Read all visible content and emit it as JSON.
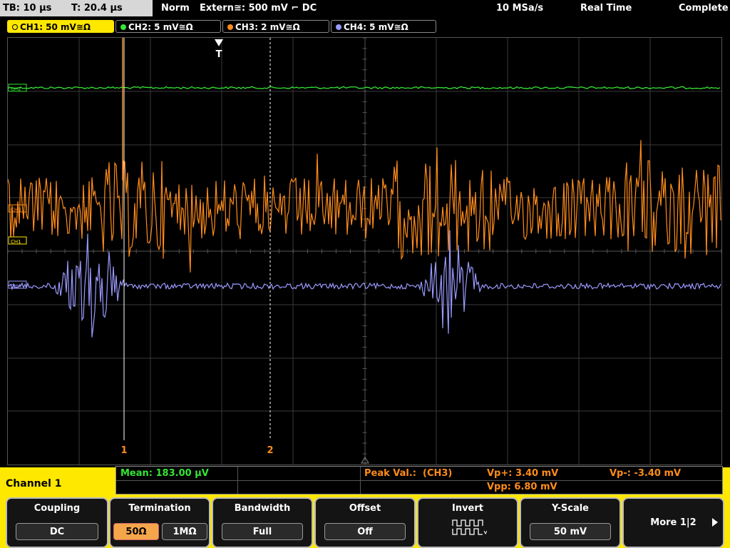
{
  "status": {
    "timebase": "TB: 10 µs",
    "trigger_time": "T: 20.4 µs",
    "mode": "Norm",
    "trigger_source": "Extern≅: 500 mV ⌐ DC",
    "sample_rate": "10 MSa/s",
    "acq_mode": "Real Time",
    "acq_state": "Complete"
  },
  "channels": [
    {
      "label": "CH1: 50 mV≅Ω",
      "color": "#ffe800",
      "active": true
    },
    {
      "label": "CH2: 5 mV≅Ω",
      "color": "#35e535"
    },
    {
      "label": "CH3: 2 mV≅Ω",
      "color": "#ff8c1a"
    },
    {
      "label": "CH4: 5 mV≅Ω",
      "color": "#9a9aff"
    }
  ],
  "trigger_marker": "T",
  "markers": {
    "m1": "1",
    "m2": "2"
  },
  "channel_refs": {
    "ch2": "CH2",
    "ch3": "CH3",
    "ch1": "CH1",
    "ch4": "CH4"
  },
  "measurements": {
    "mean": "Mean: 183.00 µV",
    "peak_label": "Peak Val.:",
    "peak_source": "(CH3)",
    "vp_plus": "Vp+: 3.40 mV",
    "vp_minus": "Vp-: -3.40 mV",
    "vpp": "Vpp: 6.80 mV"
  },
  "panel_title": "Channel 1",
  "softkeys": {
    "coupling": {
      "title": "Coupling",
      "value": "DC"
    },
    "termination": {
      "title": "Termination",
      "opt1": "50Ω",
      "opt2": "1MΩ"
    },
    "bandwidth": {
      "title": "Bandwidth",
      "value": "Full"
    },
    "offset": {
      "title": "Offset",
      "value": "Off"
    },
    "invert": {
      "title": "Invert"
    },
    "yscale": {
      "title": "Y-Scale",
      "value": "50 mV"
    },
    "more": {
      "title": "More 1|2"
    }
  },
  "colors": {
    "ch1": "#ffe800",
    "ch2": "#35e535",
    "ch3": "#ff8c1a",
    "ch4": "#9a9aff",
    "meas_green": "#35e535",
    "meas_orange": "#ff8c1a"
  }
}
